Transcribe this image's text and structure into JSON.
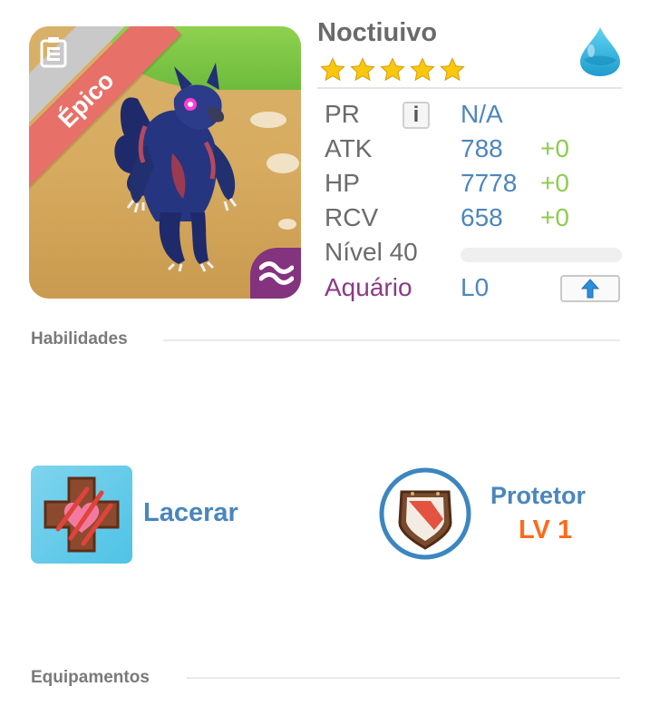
{
  "monster": {
    "name": "Noctiuivo",
    "rarity": "Épico",
    "stars": 5,
    "element_icon": "water-drop-icon",
    "colors": {
      "rarity": "#e77068",
      "stat_value": "#4d86bd",
      "stat_bonus": "#8ccd50",
      "aquarium": "#8a3a86",
      "level_text": "#ff6a1a",
      "star": "#f9c80e"
    }
  },
  "stats": {
    "pr": {
      "label": "PR",
      "value": "N/A"
    },
    "atk": {
      "label": "ATK",
      "value": "788",
      "bonus": "+0"
    },
    "hp": {
      "label": "HP",
      "value": "7778",
      "bonus": "+0"
    },
    "rcv": {
      "label": "RCV",
      "value": "658",
      "bonus": "+0"
    },
    "level": {
      "label": "Nível 40",
      "progress": 0
    },
    "aquarium": {
      "label": "Aquário",
      "value": "L0"
    }
  },
  "sections": {
    "skills": "Habilidades",
    "equipment": "Equipamentos"
  },
  "skills": {
    "active": {
      "name": "Lacerar",
      "icon": "lacerate-heart-icon"
    },
    "passive": {
      "name": "Protetor",
      "level": "LV 1",
      "icon": "protector-shield-icon"
    }
  }
}
